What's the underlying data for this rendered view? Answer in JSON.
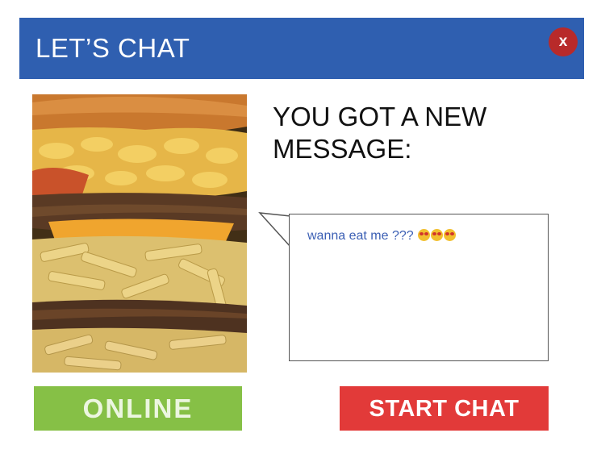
{
  "window": {
    "title": "LET’S CHAT",
    "close_label": "x"
  },
  "content": {
    "headline": "YOU GOT A NEW MESSAGE:",
    "message_text": "wanna eat me ???",
    "message_emojis": [
      "star-struck-emoji",
      "star-struck-emoji",
      "star-struck-emoji"
    ],
    "image": "burger-with-mac-and-cheese-and-fries-image"
  },
  "actions": {
    "status_label": "ONLINE",
    "start_label": "START CHAT"
  },
  "colors": {
    "titlebar": "#2f5fb0",
    "close": "#b82a2a",
    "online": "#86c046",
    "start": "#e23a39",
    "message": "#3b5fb4"
  }
}
